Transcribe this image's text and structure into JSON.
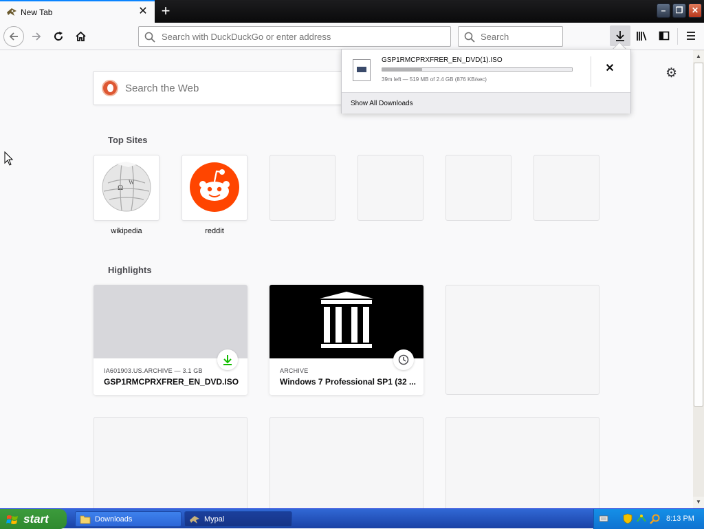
{
  "browser": {
    "tab": {
      "title": "New Tab"
    },
    "newtab_label": "+",
    "urlbar": {
      "placeholder": "Search with DuckDuckGo or enter address"
    },
    "searchbar": {
      "placeholder": "Search"
    }
  },
  "newtab": {
    "web_search_placeholder": "Search the Web",
    "top_sites_title": "Top Sites",
    "top_sites": [
      {
        "label": "wikipedia",
        "icon": "wikipedia-icon"
      },
      {
        "label": "reddit",
        "icon": "reddit-icon"
      },
      {
        "label": ""
      },
      {
        "label": ""
      },
      {
        "label": ""
      },
      {
        "label": ""
      }
    ],
    "highlights_title": "Highlights",
    "highlights": [
      {
        "meta": "IA601903.US.ARCHIVE — 3.1 GB",
        "title": "GSP1RMCPRXFRER_EN_DVD.ISO",
        "badge": "download-icon"
      },
      {
        "meta": "ARCHIVE",
        "title": "Windows 7 Professional SP1 (32 ...",
        "badge": "clock-icon"
      }
    ]
  },
  "downloads_panel": {
    "file_name": "GSP1RMCPRXFRER_EN_DVD(1).ISO",
    "progress_fraction": 0.21,
    "status": "39m left — 519 MB of 2.4 GB (876 KB/sec)",
    "show_all_label": "Show All Downloads"
  },
  "taskbar": {
    "start_label": "start",
    "items": [
      {
        "label": "Downloads"
      },
      {
        "label": "Mypal"
      }
    ],
    "clock": "8:13 PM"
  },
  "colors": {
    "accent": "#0a84ff",
    "reddit": "#ff4500",
    "download_green": "#12bc00",
    "taskbar_blue": "#245edb",
    "start_green": "#3c9b3c"
  }
}
